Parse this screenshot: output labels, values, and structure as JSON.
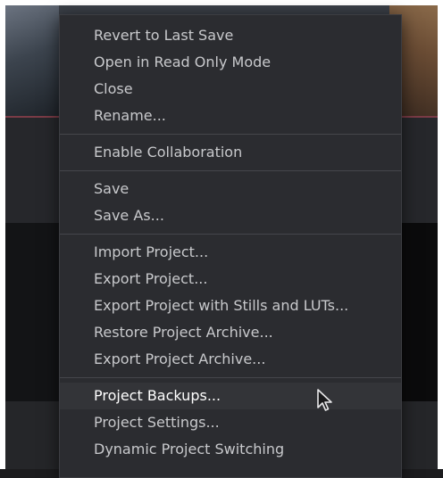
{
  "menu": {
    "groups": [
      {
        "items": [
          "Revert to Last Save",
          "Open in Read Only Mode",
          "Close",
          "Rename..."
        ]
      },
      {
        "items": [
          "Enable Collaboration"
        ]
      },
      {
        "items": [
          "Save",
          "Save As..."
        ]
      },
      {
        "items": [
          "Import Project...",
          "Export Project...",
          "Export Project with Stills and LUTs...",
          "Restore Project Archive...",
          "Export Project Archive..."
        ]
      },
      {
        "items": [
          "Project Backups...",
          "Project Settings...",
          "Dynamic Project Switching"
        ]
      }
    ],
    "hovered_item": "Project Backups..."
  }
}
